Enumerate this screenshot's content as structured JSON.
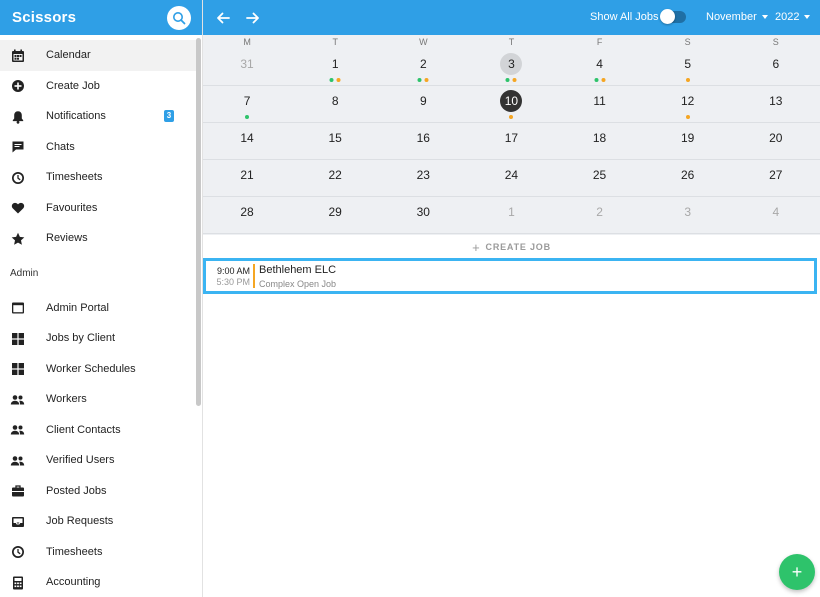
{
  "app": {
    "title": "Scissors"
  },
  "sidebar": {
    "items": [
      {
        "label": "Calendar",
        "icon": "calendar-icon",
        "active": true
      },
      {
        "label": "Create Job",
        "icon": "add-circle-icon"
      },
      {
        "label": "Notifications",
        "icon": "bell-icon",
        "badge": "3"
      },
      {
        "label": "Chats",
        "icon": "chat-icon"
      },
      {
        "label": "Timesheets",
        "icon": "clock-icon"
      },
      {
        "label": "Favourites",
        "icon": "heart-icon"
      },
      {
        "label": "Reviews",
        "icon": "star-icon"
      }
    ],
    "admin_label": "Admin",
    "admin_items": [
      {
        "label": "Admin Portal",
        "icon": "window-icon"
      },
      {
        "label": "Jobs by Client",
        "icon": "grid-icon"
      },
      {
        "label": "Worker Schedules",
        "icon": "grid-icon"
      },
      {
        "label": "Workers",
        "icon": "people-icon"
      },
      {
        "label": "Client Contacts",
        "icon": "people-icon"
      },
      {
        "label": "Verified Users",
        "icon": "people-icon"
      },
      {
        "label": "Posted Jobs",
        "icon": "briefcase-icon"
      },
      {
        "label": "Job Requests",
        "icon": "inbox-icon"
      },
      {
        "label": "Timesheets",
        "icon": "clock-icon"
      },
      {
        "label": "Accounting",
        "icon": "calculator-icon"
      }
    ]
  },
  "topbar": {
    "show_all_label": "Show All Jobs",
    "show_all_on": false,
    "month": "November",
    "year": "2022"
  },
  "calendar": {
    "weekdays": [
      "M",
      "T",
      "W",
      "T",
      "F",
      "S",
      "S"
    ],
    "weeks": [
      [
        {
          "n": "31",
          "muted": true
        },
        {
          "n": "1",
          "dots": [
            "green",
            "orange"
          ]
        },
        {
          "n": "2",
          "dots": [
            "green",
            "orange"
          ]
        },
        {
          "n": "3",
          "selected": true,
          "dots": [
            "green",
            "orange"
          ]
        },
        {
          "n": "4",
          "dots": [
            "green",
            "orange"
          ]
        },
        {
          "n": "5",
          "dots": [
            "orange"
          ]
        },
        {
          "n": "6"
        }
      ],
      [
        {
          "n": "7",
          "dots": [
            "green"
          ]
        },
        {
          "n": "8"
        },
        {
          "n": "9"
        },
        {
          "n": "10",
          "today": true,
          "dots": [
            "orange"
          ]
        },
        {
          "n": "11"
        },
        {
          "n": "12",
          "dots": [
            "orange"
          ]
        },
        {
          "n": "13"
        }
      ],
      [
        {
          "n": "14"
        },
        {
          "n": "15"
        },
        {
          "n": "16"
        },
        {
          "n": "17"
        },
        {
          "n": "18"
        },
        {
          "n": "19"
        },
        {
          "n": "20"
        }
      ],
      [
        {
          "n": "21"
        },
        {
          "n": "22"
        },
        {
          "n": "23"
        },
        {
          "n": "24"
        },
        {
          "n": "25"
        },
        {
          "n": "26"
        },
        {
          "n": "27"
        }
      ],
      [
        {
          "n": "28"
        },
        {
          "n": "29"
        },
        {
          "n": "30"
        },
        {
          "n": "1",
          "muted": true
        },
        {
          "n": "2",
          "muted": true
        },
        {
          "n": "3",
          "muted": true
        },
        {
          "n": "4",
          "muted": true
        }
      ]
    ]
  },
  "create_job_label": "CREATE JOB",
  "job": {
    "start": "9:00 AM",
    "end": "5:30 PM",
    "title": "Bethlehem ELC",
    "subtitle": "Complex Open Job"
  },
  "colors": {
    "brand": "#2f9fe6",
    "dot_green": "#2ec36b",
    "dot_orange": "#f5a623",
    "fab": "#2ec36b",
    "job_border": "#3bb4f2"
  }
}
